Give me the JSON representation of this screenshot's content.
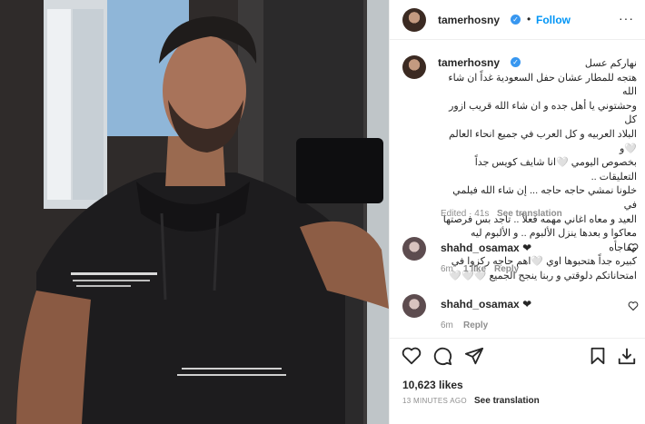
{
  "post": {
    "username": "tamerhosny",
    "follow_label": "Follow",
    "dot": "•",
    "more_label": "···",
    "caption": {
      "lines": [
        "نهاركم عسل",
        "هتجه للمطار عشان حفل السعودية غداً ان شاء الله",
        "وحشتوني يا أهل جده و ان شاء الله قريب ازور كل",
        "البلاد العربيه و كل العرب في جميع انحاء العالم🤍و",
        "بخصوص اليومي 🤍انا شايف كويس جداً التعليقات ..",
        "خلونا نمشي حاجه حاجه ... إن شاء الله فيلمي في",
        "العيد و معاه اغاني مهمه فعلاً .. تاجد بس فرصتها",
        "معاكوا و بعدها ينزل الألبوم .. و الألبوم ليه مفاجأه",
        "كبيره جداً هتحبوها اوي 🤍اهم حاجه ركزوا في",
        "امتحاناتكم دلوقتي و ربنا ينجح الجميع 🤍🤍🤍"
      ],
      "edited_label": "Edited",
      "edited_time": "41s",
      "see_translation": "See translation"
    },
    "comments": [
      {
        "username": "shahd_osamax",
        "emoji": "❤",
        "time": "6m",
        "likes": "1 like",
        "reply": "Reply"
      },
      {
        "username": "shahd_osamax",
        "emoji": "❤",
        "time": "6m",
        "reply": "Reply"
      }
    ],
    "likes": "10,623 likes",
    "posted_ago": "13 MINUTES AGO",
    "see_translation": "See translation"
  },
  "colors": {
    "accent": "#0095f6",
    "verified": "#3897f0",
    "text": "#262626",
    "muted": "#8e8e8e"
  },
  "icons": [
    "verified-badge-icon",
    "more-options-icon",
    "heart-icon",
    "comment-icon",
    "share-icon",
    "save-icon",
    "download-icon"
  ]
}
